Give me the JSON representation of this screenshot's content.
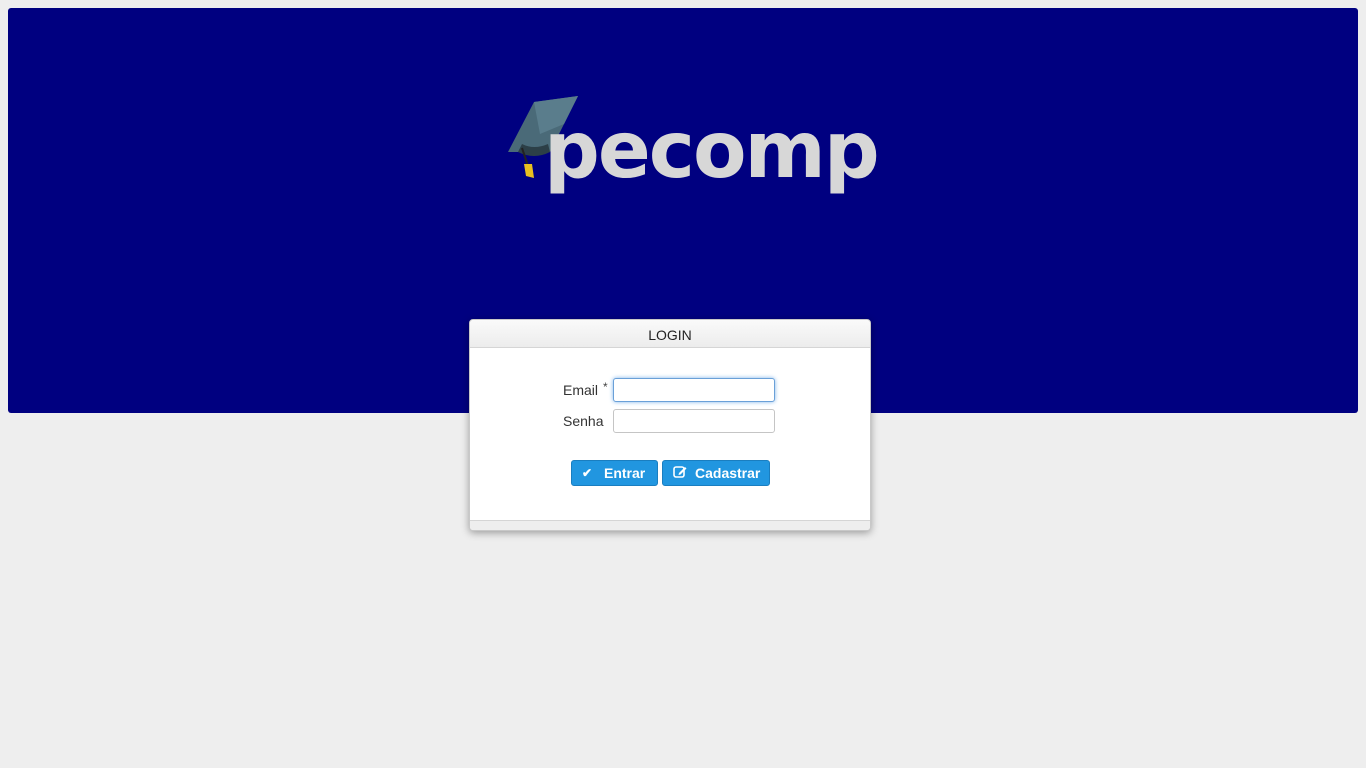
{
  "logo": {
    "text": "pecomp",
    "icon": "graduation-cap-icon"
  },
  "colors": {
    "banner": "#000080",
    "button": "#2196e0",
    "background": "#eeeeee"
  },
  "login": {
    "title": "LOGIN",
    "email_label": "Email",
    "required_marker": "*",
    "email_value": "",
    "password_label": "Senha",
    "password_value": "",
    "submit_label": "Entrar",
    "submit_icon": "check-icon",
    "register_label": "Cadastrar",
    "register_icon": "edit-icon"
  }
}
